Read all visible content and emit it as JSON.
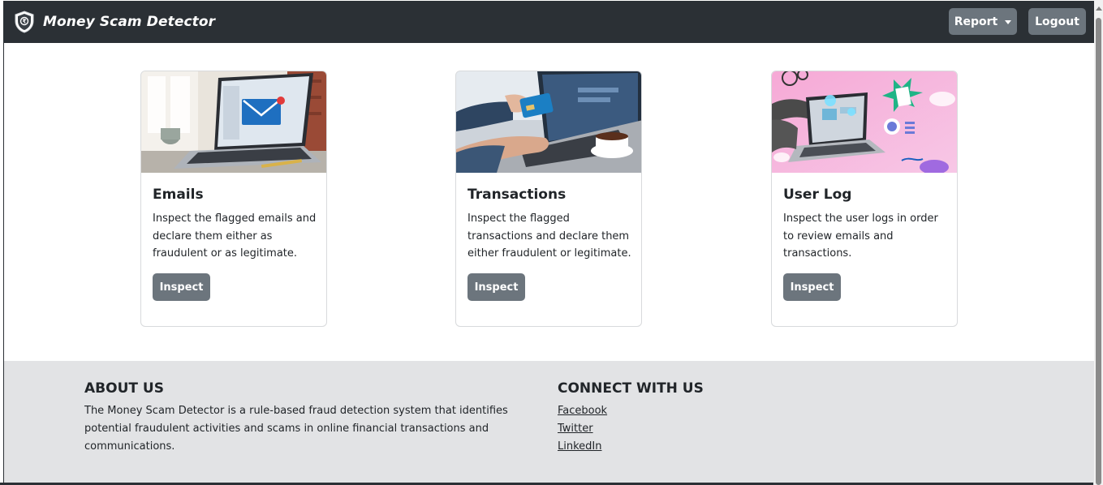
{
  "navbar": {
    "brand": "Money Scam Detector",
    "logo_icon": "shield-logo-icon",
    "report_label": "Report",
    "logout_label": "Logout",
    "background": "#2b3035"
  },
  "cards": [
    {
      "title": "Emails",
      "text": "Inspect the flagged emails and declare them either as fraudulent or as legitimate.",
      "button": "Inspect"
    },
    {
      "title": "Transactions",
      "text": "Inspect the flagged transactions and declare them either fraudulent or legitimate.",
      "button": "Inspect"
    },
    {
      "title": "User Log",
      "text": "Inspect the user logs in order to review emails and transactions.",
      "button": "Inspect"
    }
  ],
  "footer": {
    "about": {
      "heading": "ABOUT US",
      "text": "The Money Scam Detector is a rule-based fraud detection system that identifies potential fraudulent activities and scams in online financial transactions and communications."
    },
    "connect": {
      "heading": "CONNECT WITH US",
      "links": [
        "Facebook",
        "Twitter",
        "LinkedIn"
      ]
    },
    "background": "#e2e3e5"
  },
  "colors": {
    "button": "#6c757d",
    "accent_blue": "#1e6fc0"
  }
}
